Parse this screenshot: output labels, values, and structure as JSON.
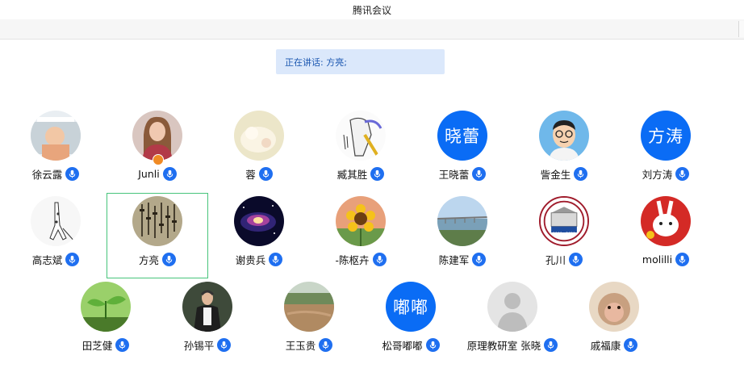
{
  "window": {
    "title": "腾讯会议"
  },
  "speaking": {
    "text": "正在讲话: 方亮;"
  },
  "colors": {
    "accent": "#1f6ff0",
    "avatar_bg": "#0a6cf5",
    "active_border": "#47c47b",
    "banner_bg": "#dbe8fb"
  },
  "participants": [
    {
      "name": "徐云露",
      "avatar": "photo-baby-icon"
    },
    {
      "name": "Junli",
      "avatar": "photo-woman-icon"
    },
    {
      "name": "蓉",
      "avatar": "photo-kitten-icon"
    },
    {
      "name": "臧其胜",
      "avatar": "sketch-figure-icon"
    },
    {
      "name": "王晓蕾",
      "avatar_text": "晓蕾"
    },
    {
      "name": "訾金生",
      "avatar": "cartoon-man-icon"
    },
    {
      "name": "刘方涛",
      "avatar_text": "方涛"
    },
    {
      "name": "高志斌",
      "avatar": "giraffe-drawing-icon"
    },
    {
      "name": "方亮",
      "avatar": "calligraphy-icon",
      "active": true
    },
    {
      "name": "谢贵兵",
      "avatar": "galaxy-icon"
    },
    {
      "name": "-陈枢卉",
      "avatar": "sunflower-icon"
    },
    {
      "name": "陈建军",
      "avatar": "bridge-landscape-icon"
    },
    {
      "name": "孔川",
      "avatar": "emblem-icon",
      "emblem_text": "1900—2020"
    },
    {
      "name": "molilli",
      "avatar": "rabbit-icon"
    },
    {
      "name": "田芝健",
      "avatar": "sprout-icon"
    },
    {
      "name": "孙锡平",
      "avatar": "photo-man-icon"
    },
    {
      "name": "王玉贵",
      "avatar": "flood-road-icon"
    },
    {
      "name": "松哥嘟嘟",
      "avatar_text": "嘟嘟"
    },
    {
      "name": "原理教研室 张晓",
      "avatar": "default-person-icon"
    },
    {
      "name": "戚福康",
      "avatar": "monkey-icon"
    }
  ]
}
